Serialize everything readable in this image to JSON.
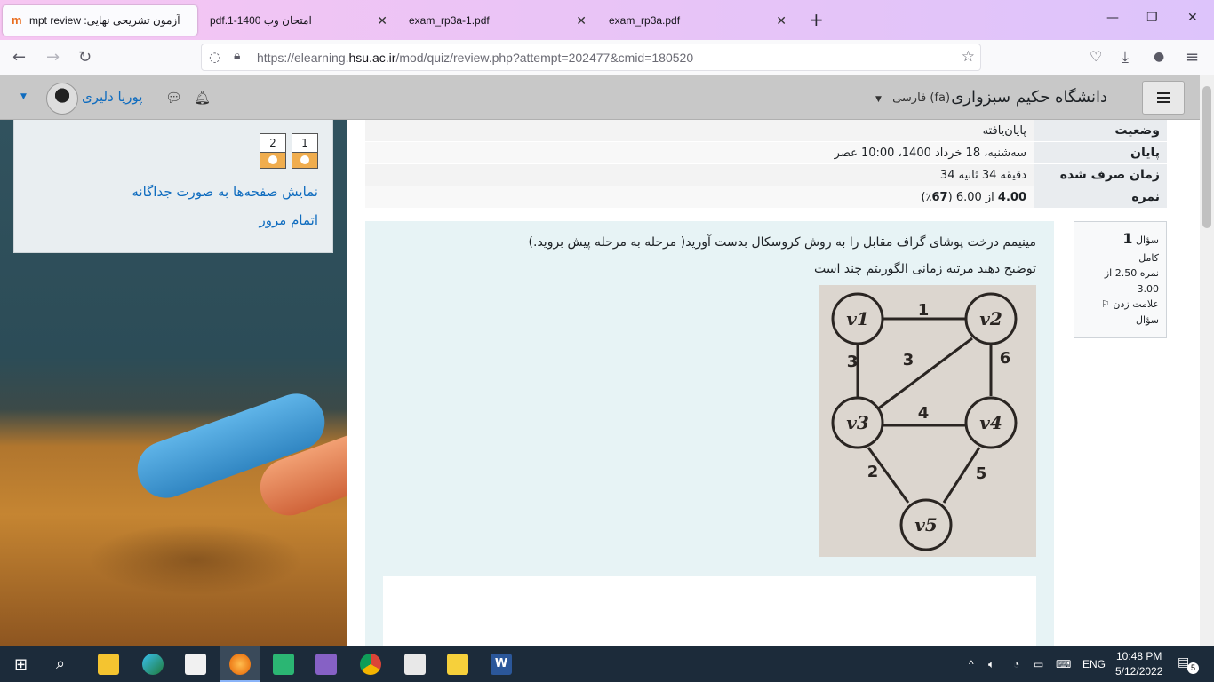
{
  "browser": {
    "tabs": [
      {
        "label": "آزمون تشریحی نهایی: Attempt review",
        "display": "آزمون تشریحی نهایی: mpt review",
        "active": true
      },
      {
        "label": "امتحان وب 1400-1.pdf",
        "active": false
      },
      {
        "label": "exam_rp3a-1.pdf",
        "active": false
      },
      {
        "label": "exam_rp3a.pdf",
        "active": false
      }
    ],
    "url_prefix": "https://elearning.",
    "url_domain": "hsu.ac.ir",
    "url_suffix": "/mod/quiz/review.php?attempt=202477&cmid=180520"
  },
  "header": {
    "site_name": "دانشگاه حکیم سبزواری",
    "language": "فارسی (fa)",
    "user_name": "پوریا دلیری"
  },
  "quiz_nav": {
    "questions": [
      "1",
      "2"
    ],
    "show_one_page": "نمایش صفحه‌ها به صورت جداگانه",
    "finish_review": "اتمام مرور"
  },
  "summary": [
    {
      "label": "وضعیت",
      "value": "پایان‌یافته"
    },
    {
      "label": "پایان",
      "value": "سه‌شنبه، 18 خرداد 1400، 10:00 عصر"
    },
    {
      "label": "زمان صرف شده",
      "value": "34 دقیقه 34 ثانیه"
    },
    {
      "label": "نمره",
      "value_bold": "4.00",
      "value_rest": " از 6.00 (",
      "value_pct": "67",
      "value_end": "٪)"
    }
  ],
  "question": {
    "label": "سؤال",
    "number": "1",
    "state": "کامل",
    "grade": "نمره 2.50 از 3.00",
    "flag": "علامت زدن سؤال",
    "text_line1": "مینیمم درخت پوشای گراف مقابل را به روش کروسکال بدست آورید( مرحله به مرحله پیش بروید.)",
    "text_line2": "توضیح دهید مرتبه زمانی الگوریتم چند است"
  },
  "graph": {
    "nodes": [
      "v1",
      "v2",
      "v3",
      "v4",
      "v5"
    ],
    "edges": [
      {
        "from": "v1",
        "to": "v2",
        "w": "1"
      },
      {
        "from": "v1",
        "to": "v3",
        "w": "3"
      },
      {
        "from": "v2",
        "to": "v3",
        "w": "3"
      },
      {
        "from": "v2",
        "to": "v4",
        "w": "6"
      },
      {
        "from": "v3",
        "to": "v4",
        "w": "4"
      },
      {
        "from": "v3",
        "to": "v5",
        "w": "2"
      },
      {
        "from": "v4",
        "to": "v5",
        "w": "5"
      }
    ]
  },
  "taskbar": {
    "language": "ENG",
    "time": "10:48 PM",
    "date": "5/12/2022",
    "notifications": "5"
  }
}
